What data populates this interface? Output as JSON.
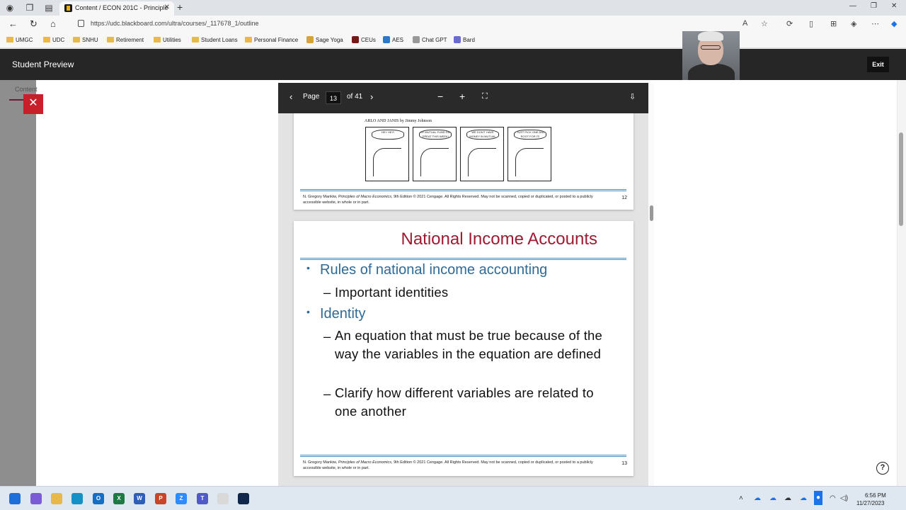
{
  "browser": {
    "tab_title": "Content / ECON 201C - Principle",
    "url": "https://udc.blackboard.com/ultra/courses/_117678_1/outline",
    "new_tab_glyph": "+",
    "close_glyph": "✕"
  },
  "bookmarks": [
    {
      "label": "UMGC",
      "kind": "folder"
    },
    {
      "label": "UDC",
      "kind": "folder"
    },
    {
      "label": "SNHU",
      "kind": "folder"
    },
    {
      "label": "Retirement",
      "kind": "folder"
    },
    {
      "label": "Utilities",
      "kind": "folder"
    },
    {
      "label": "Student Loans",
      "kind": "folder"
    },
    {
      "label": "Personal Finance",
      "kind": "folder"
    },
    {
      "label": "Sage Yoga",
      "kind": "site",
      "color": "#d8a23a"
    },
    {
      "label": "CEUs",
      "kind": "site",
      "color": "#7a1616"
    },
    {
      "label": "AES",
      "kind": "site",
      "color": "#2c78c8"
    },
    {
      "label": "Chat GPT",
      "kind": "site",
      "color": "#999999"
    },
    {
      "label": "Bard",
      "kind": "site",
      "color": "#6a6ad8"
    }
  ],
  "header": {
    "title": "Student Preview",
    "exit_label": "Exit"
  },
  "side": {
    "content_tab": "Content",
    "close_glyph": "✕"
  },
  "pdf": {
    "page_label": "Page",
    "current_page": "13",
    "of_label": "of 41",
    "zoom_out": "−",
    "zoom_in": "+"
  },
  "slide12": {
    "comic_caption": "ARLO AND JANIS by Jimmy Johnson",
    "panels": [
      "HEY HEY!",
      "MY MUTUAL FUND DID GREAT THIS WEEK!",
      "WE DON'T HAVE MONEY IN MUTUAL FUNDS!",
      "I JUST PICK ONE AND ROOT FOR IT!"
    ],
    "footnote_prefix": "N. Gregory Mankiw, ",
    "footnote_book": "Principles of Macro Economics",
    "footnote_suffix": ", 9th Edition © 2021 Cengage. All Rights Reserved. May not be scanned, copied or duplicated, or posted to a publicly accessible website, in whole or in part.",
    "page_number": "12"
  },
  "slide13": {
    "title": "National Income Accounts",
    "bullets": [
      {
        "text": "Rules of national income accounting",
        "sub": [
          "Important identities"
        ]
      },
      {
        "text": "Identity",
        "sub": [
          "An equation that must be true because of the way the variables in the equation are defined",
          "Clarify how different variables are related to one another"
        ]
      }
    ],
    "footnote_prefix": "N. Gregory Mankiw, ",
    "footnote_book": "Principles of Macro Economics",
    "footnote_suffix": ", 9th Edition © 2021 Cengage. All Rights Reserved. May not be scanned, copied or duplicated, or posted to a publicly accessible website, in whole or in part.",
    "page_number": "13"
  },
  "help": "?",
  "taskbar": {
    "time": "6:56 PM",
    "date": "11/27/2023",
    "apps": [
      {
        "name": "windows-start",
        "color": "#1e6fd9",
        "glyph": ""
      },
      {
        "name": "copilot",
        "color": "#7b5cd6",
        "glyph": ""
      },
      {
        "name": "file-explorer",
        "color": "#e8b94a",
        "glyph": ""
      },
      {
        "name": "edge",
        "color": "#1591c8",
        "glyph": ""
      },
      {
        "name": "outlook",
        "color": "#1470c4",
        "glyph": "O"
      },
      {
        "name": "excel",
        "color": "#1d7a43",
        "glyph": "X"
      },
      {
        "name": "word",
        "color": "#2b5fb8",
        "glyph": "W"
      },
      {
        "name": "powerpoint",
        "color": "#c8452a",
        "glyph": "P"
      },
      {
        "name": "zoom",
        "color": "#2d8cff",
        "glyph": "Z"
      },
      {
        "name": "teams",
        "color": "#5059c9",
        "glyph": "T"
      },
      {
        "name": "slack",
        "color": "#d9d9d9",
        "glyph": ""
      },
      {
        "name": "terminal",
        "color": "#12284a",
        "glyph": ""
      }
    ]
  },
  "colors": {
    "title_red": "#9e1b32",
    "bullet_blue": "#2e6a96",
    "header_bg": "#262626",
    "close_red": "#c8202a"
  }
}
